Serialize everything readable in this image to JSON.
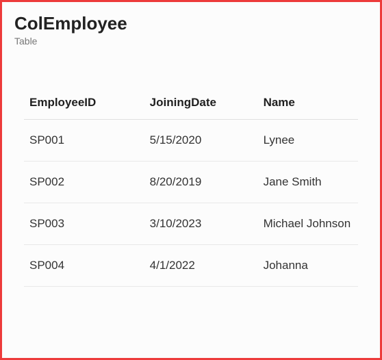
{
  "header": {
    "title": "ColEmployee",
    "subtitle": "Table"
  },
  "table": {
    "columns": [
      "EmployeeID",
      "JoiningDate",
      "Name"
    ],
    "rows": [
      {
        "EmployeeID": "SP001",
        "JoiningDate": "5/15/2020",
        "Name": "Lynee"
      },
      {
        "EmployeeID": "SP002",
        "JoiningDate": "8/20/2019",
        "Name": "Jane Smith"
      },
      {
        "EmployeeID": "SP003",
        "JoiningDate": "3/10/2023",
        "Name": "Michael Johnson"
      },
      {
        "EmployeeID": "SP004",
        "JoiningDate": "4/1/2022",
        "Name": "Johanna"
      }
    ]
  }
}
